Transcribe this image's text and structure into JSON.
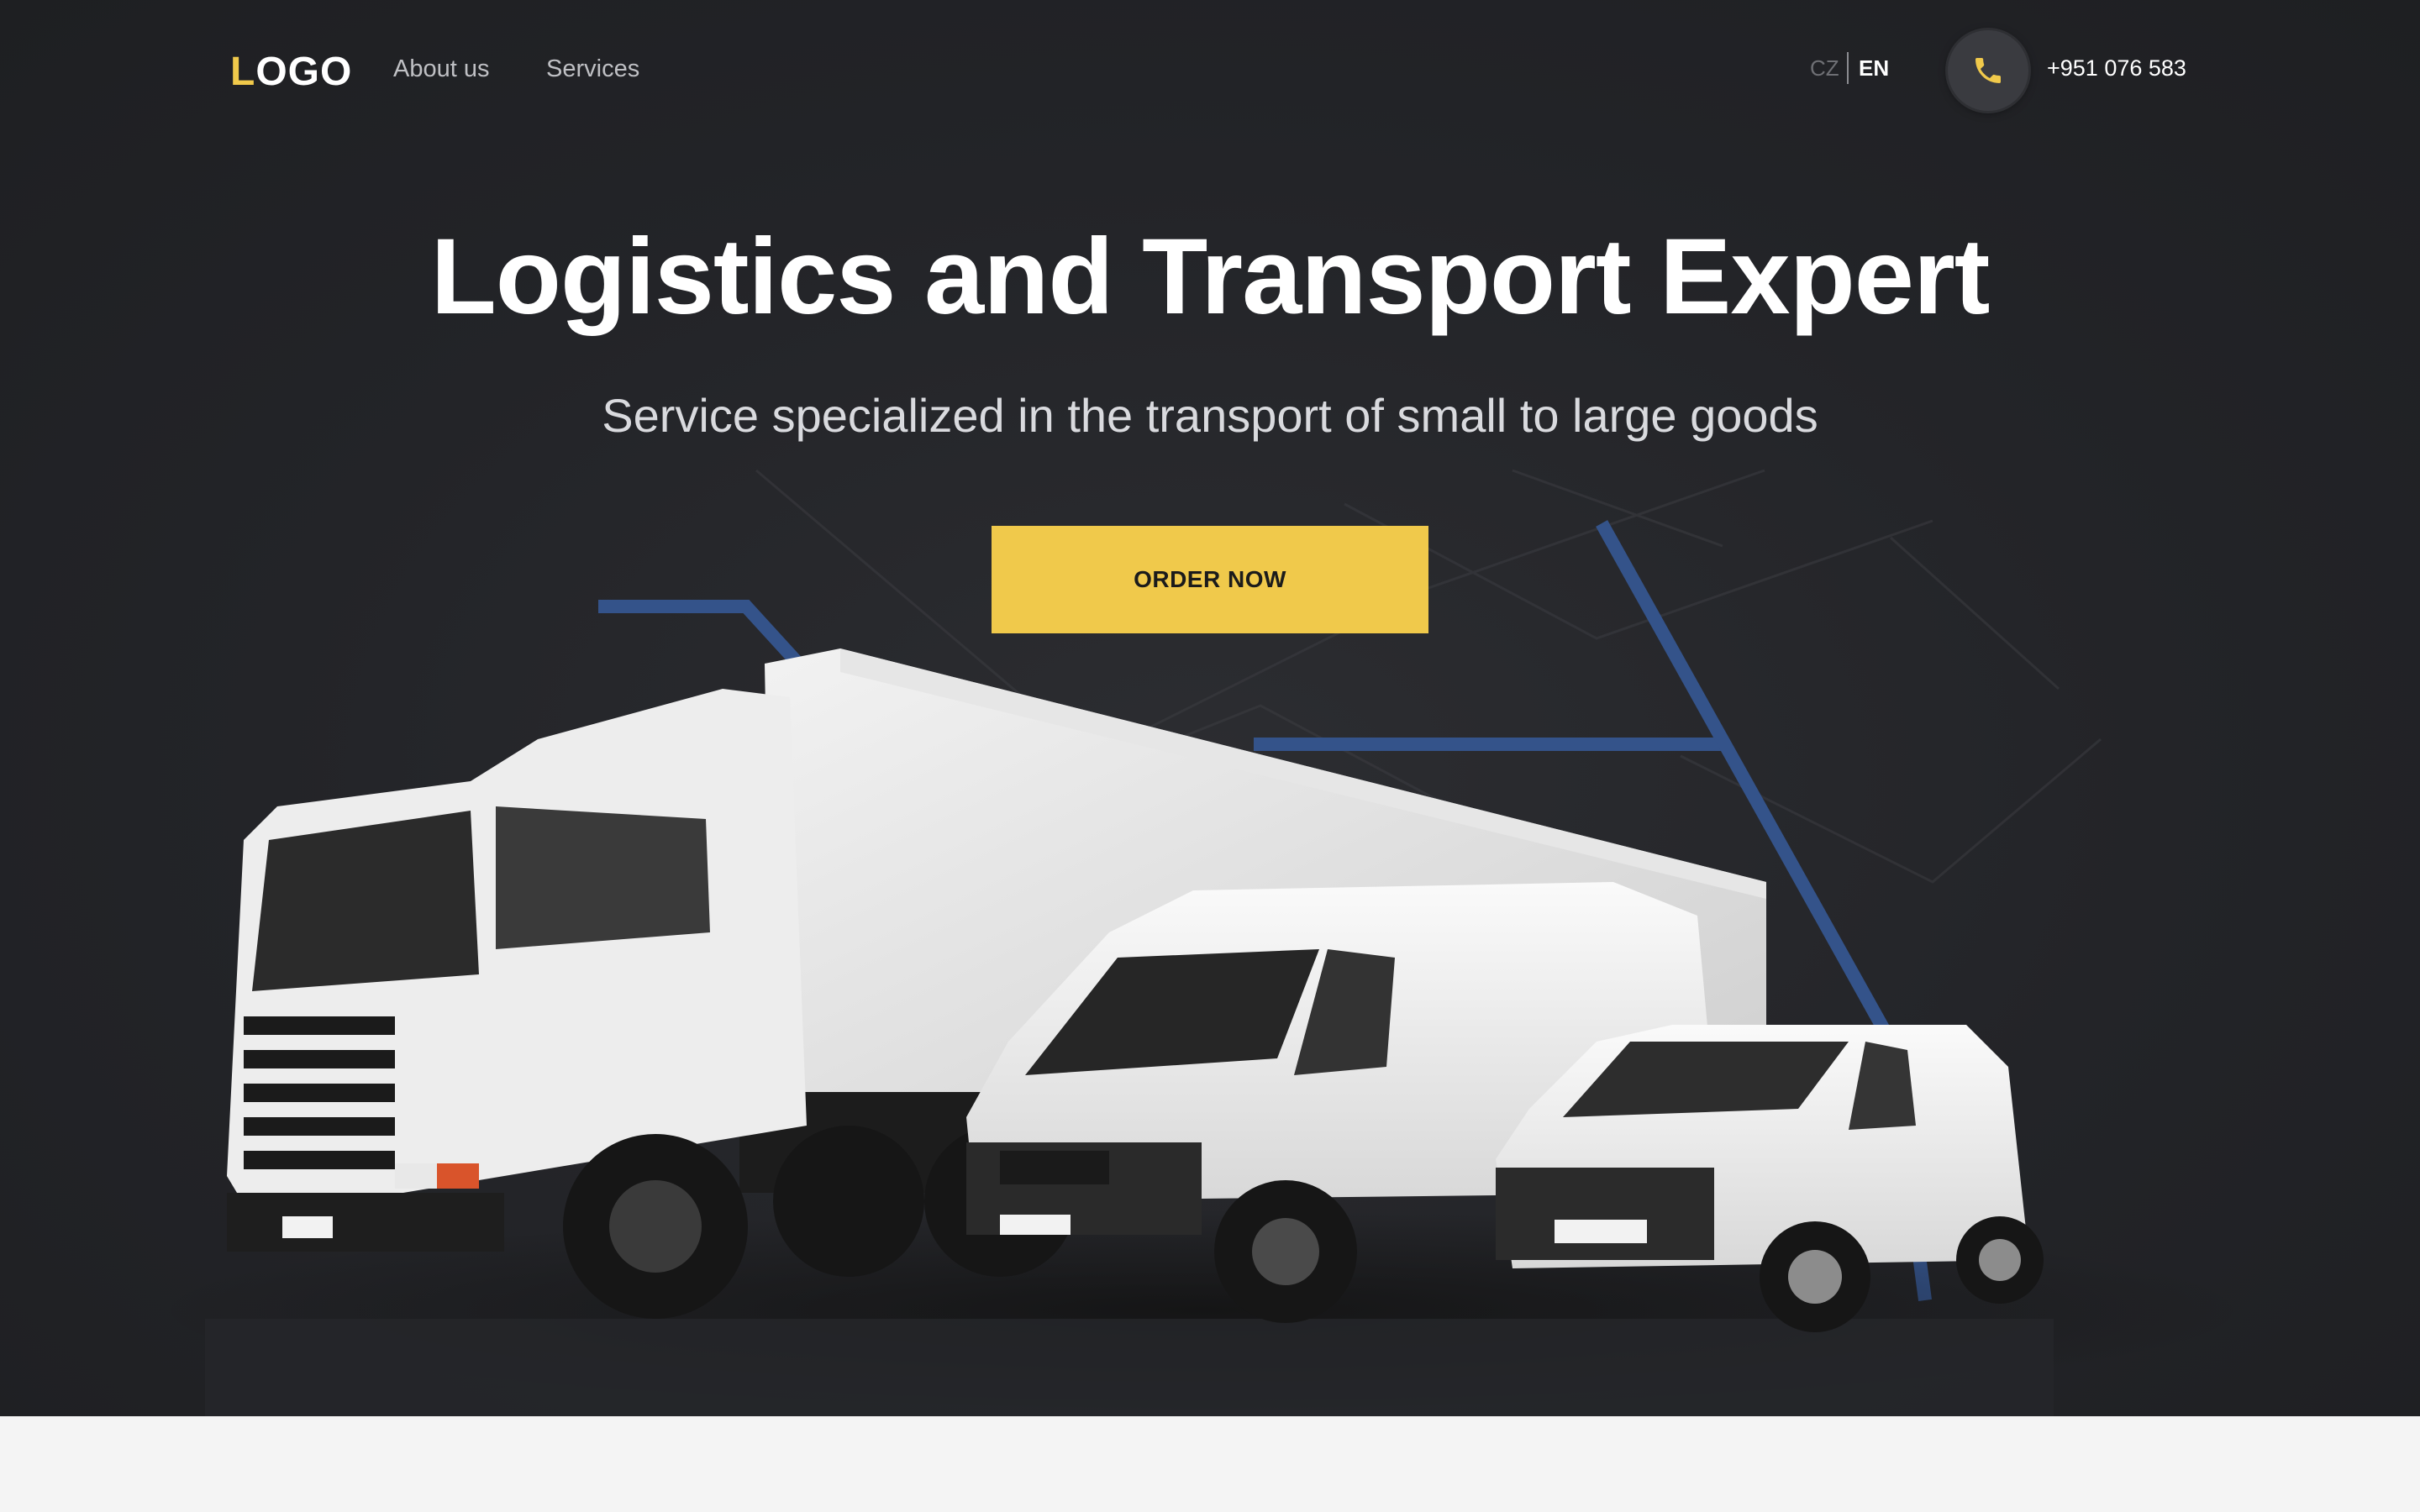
{
  "header": {
    "logo_first": "L",
    "logo_rest": "OGO",
    "nav": [
      "About us",
      "Services"
    ],
    "languages": [
      "CZ",
      "EN"
    ],
    "active_language": "EN",
    "phone": "+951 076 583",
    "phone_icon": "phone-icon"
  },
  "hero": {
    "title": "Logistics and Transport Expert",
    "subtitle": "Service specialized in the transport of small to large goods",
    "cta_label": "ORDER NOW"
  },
  "colors": {
    "accent": "#f0c94b",
    "background": "#232428",
    "route_lines": "#3b5a94",
    "section_below": "#f4f4f4"
  },
  "image": {
    "description_icon": "vehicle-fleet-image"
  }
}
